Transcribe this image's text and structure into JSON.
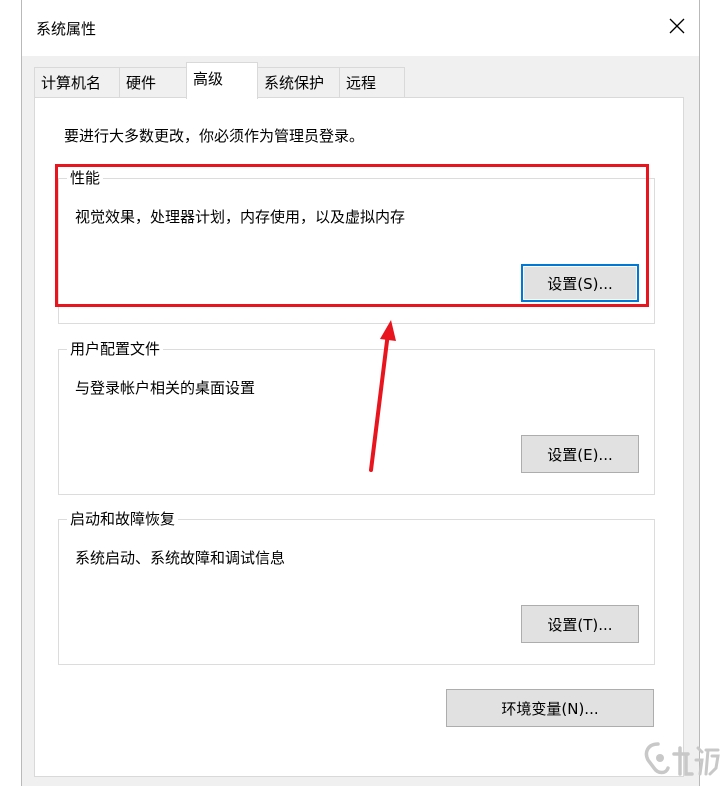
{
  "window": {
    "title": "系统属性"
  },
  "tabs": [
    {
      "label": "计算机名"
    },
    {
      "label": "硬件"
    },
    {
      "label": "高级"
    },
    {
      "label": "系统保护"
    },
    {
      "label": "远程"
    }
  ],
  "advanced": {
    "notice": "要进行大多数更改，你必须作为管理员登录。",
    "performance": {
      "label": "性能",
      "description": "视觉效果，处理器计划，内存使用，以及虚拟内存",
      "button_label": "设置(S)..."
    },
    "user_profiles": {
      "label": "用户配置文件",
      "description": "与登录帐户相关的桌面设置",
      "button_label": "设置(E)..."
    },
    "startup_recovery": {
      "label": "启动和故障恢复",
      "description": "系统启动、系统故障和调试信息",
      "button_label": "设置(T)..."
    },
    "env_button_label": "环境变量(N)..."
  },
  "colors": {
    "annotation": "#e8141e",
    "focus": "#0078d7"
  },
  "icons": {
    "close": "close-icon",
    "annotation_arrow": "arrow-up-icon"
  }
}
